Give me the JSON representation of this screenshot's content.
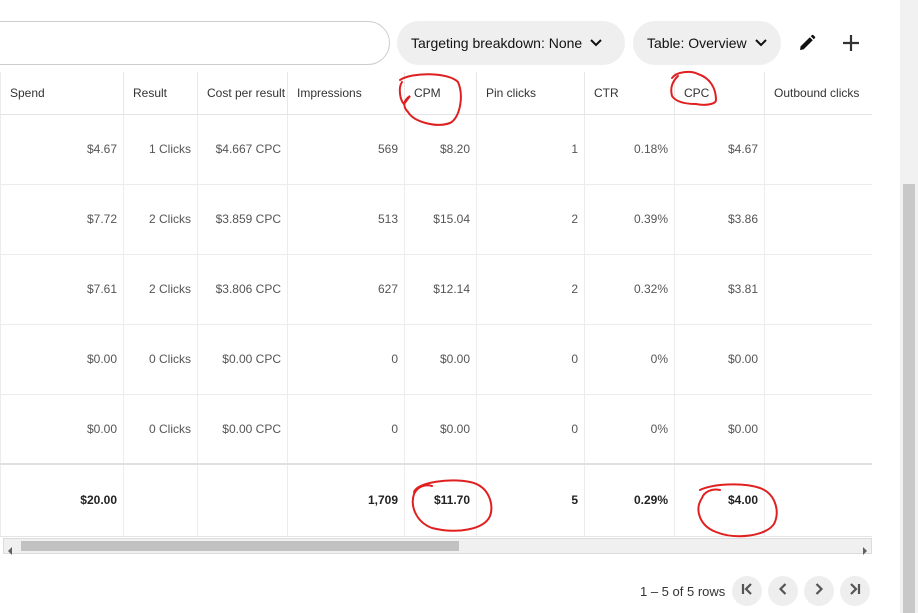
{
  "toolbar": {
    "targeting_breakdown_label": "Targeting breakdown: None",
    "table_label": "Table: Overview"
  },
  "table": {
    "headers": [
      "Spend",
      "Result",
      "Cost per result",
      "Impressions",
      "CPM",
      "Pin clicks",
      "CTR",
      "CPC",
      "Outbound clicks"
    ],
    "rows": [
      [
        "$4.67",
        "1 Clicks",
        "$4.667 CPC",
        "569",
        "$8.20",
        "1",
        "0.18%",
        "$4.67",
        ""
      ],
      [
        "$7.72",
        "2 Clicks",
        "$3.859 CPC",
        "513",
        "$15.04",
        "2",
        "0.39%",
        "$3.86",
        ""
      ],
      [
        "$7.61",
        "2 Clicks",
        "$3.806 CPC",
        "627",
        "$12.14",
        "2",
        "0.32%",
        "$3.81",
        ""
      ],
      [
        "$0.00",
        "0 Clicks",
        "$0.00 CPC",
        "0",
        "$0.00",
        "0",
        "0%",
        "$0.00",
        ""
      ],
      [
        "$0.00",
        "0 Clicks",
        "$0.00 CPC",
        "0",
        "$0.00",
        "0",
        "0%",
        "$0.00",
        ""
      ]
    ],
    "totals": [
      "$20.00",
      "",
      "",
      "1,709",
      "$11.70",
      "5",
      "0.29%",
      "$4.00",
      ""
    ]
  },
  "pagination": {
    "summary": "1 – 5 of 5 rows"
  },
  "colors": {
    "annotation": "#e02020",
    "pill_bg": "#efefef"
  },
  "icons": {
    "edit": "pencil-icon",
    "add": "plus-icon",
    "first": "first-page-icon",
    "prev": "chevron-left-icon",
    "next": "chevron-right-icon",
    "last": "last-page-icon"
  }
}
